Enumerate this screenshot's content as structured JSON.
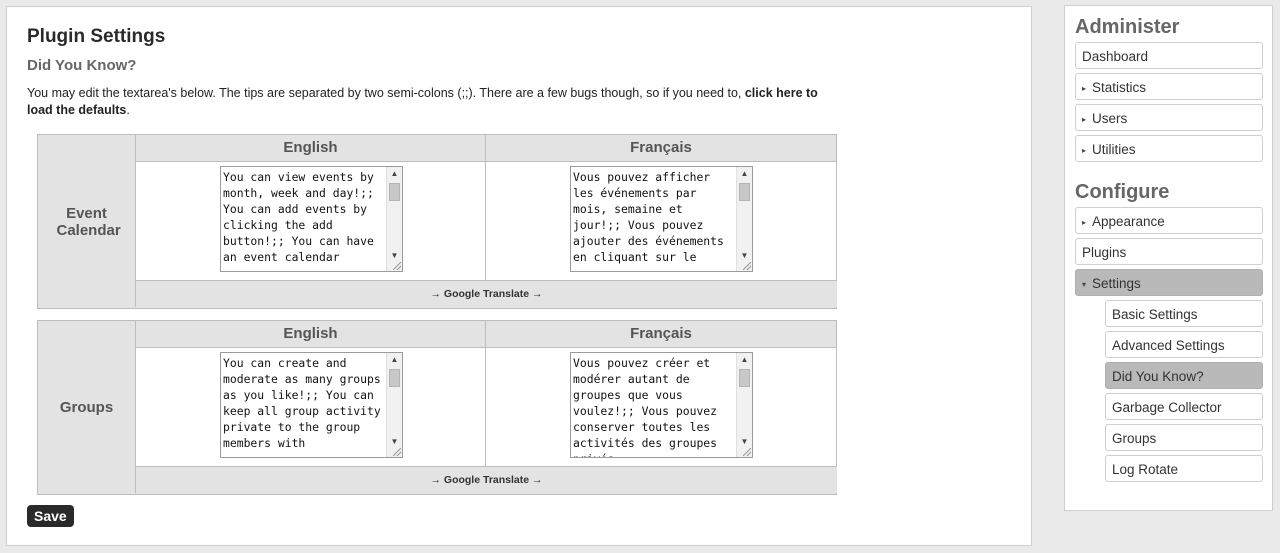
{
  "page": {
    "title": "Plugin Settings",
    "subtitle": "Did You Know?",
    "intro_text": "You may edit the textarea's below. The tips are separated by two semi-colons (;;). There are a few bugs though, so if you need to, ",
    "intro_link": "click here to load the defaults",
    "intro_end": "."
  },
  "blocks": [
    {
      "label": "Event Calendar",
      "english_header": "English",
      "french_header": "Français",
      "english_text": "You can view events by month, week and day!;; You can add events by clicking the add button!;; You can have an event calendar",
      "french_text": "Vous pouvez afficher les événements par mois, semaine et jour!;; Vous pouvez ajouter des événements en cliquant sur le",
      "translate_label": "→ Google Translate →"
    },
    {
      "label": "Groups",
      "english_header": "English",
      "french_header": "Français",
      "english_text": "You can create and moderate as many groups as you like!;; You can keep all group activity private to the group members with",
      "french_text": "Vous pouvez créer et modérer autant de groupes que vous voulez!;; Vous pouvez conserver toutes les activités des groupes privés",
      "translate_label": "→ Google Translate →"
    }
  ],
  "save_label": "Save",
  "sidebar": {
    "administer_heading": "Administer",
    "administer_items": [
      {
        "label": "Dashboard",
        "arrow": ""
      },
      {
        "label": "Statistics",
        "arrow": "▸"
      },
      {
        "label": "Users",
        "arrow": "▸"
      },
      {
        "label": "Utilities",
        "arrow": "▸"
      }
    ],
    "configure_heading": "Configure",
    "configure_items": [
      {
        "label": "Appearance",
        "arrow": "▸"
      },
      {
        "label": "Plugins",
        "arrow": ""
      },
      {
        "label": "Settings",
        "arrow": "▾"
      }
    ],
    "settings_subitems": [
      {
        "label": "Basic Settings"
      },
      {
        "label": "Advanced Settings"
      },
      {
        "label": "Did You Know?"
      },
      {
        "label": "Garbage Collector"
      },
      {
        "label": "Groups"
      },
      {
        "label": "Log Rotate"
      }
    ]
  }
}
